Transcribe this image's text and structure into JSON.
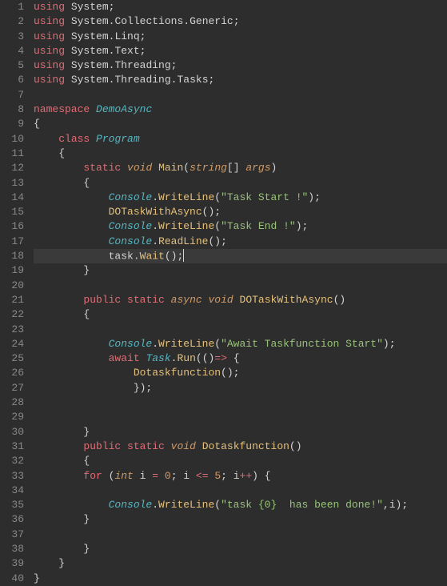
{
  "editor": {
    "cursor_line": 18,
    "line_count": 40,
    "lines": [
      [
        [
          1,
          "using"
        ],
        [
          0,
          " "
        ],
        [
          5,
          "System"
        ],
        [
          0,
          ";"
        ]
      ],
      [
        [
          1,
          "using"
        ],
        [
          0,
          " "
        ],
        [
          5,
          "System"
        ],
        [
          0,
          "."
        ],
        [
          5,
          "Collections"
        ],
        [
          0,
          "."
        ],
        [
          5,
          "Generic"
        ],
        [
          0,
          ";"
        ]
      ],
      [
        [
          1,
          "using"
        ],
        [
          0,
          " "
        ],
        [
          5,
          "System"
        ],
        [
          0,
          "."
        ],
        [
          5,
          "Linq"
        ],
        [
          0,
          ";"
        ]
      ],
      [
        [
          1,
          "using"
        ],
        [
          0,
          " "
        ],
        [
          5,
          "System"
        ],
        [
          0,
          "."
        ],
        [
          5,
          "Text"
        ],
        [
          0,
          ";"
        ]
      ],
      [
        [
          1,
          "using"
        ],
        [
          0,
          " "
        ],
        [
          5,
          "System"
        ],
        [
          0,
          "."
        ],
        [
          5,
          "Threading"
        ],
        [
          0,
          ";"
        ]
      ],
      [
        [
          1,
          "using"
        ],
        [
          0,
          " "
        ],
        [
          5,
          "System"
        ],
        [
          0,
          "."
        ],
        [
          5,
          "Threading"
        ],
        [
          0,
          "."
        ],
        [
          5,
          "Tasks"
        ],
        [
          0,
          ";"
        ]
      ],
      [],
      [
        [
          1,
          "namespace"
        ],
        [
          0,
          " "
        ],
        [
          6,
          "DemoAsync"
        ]
      ],
      [
        [
          0,
          "{"
        ]
      ],
      [
        [
          0,
          "    "
        ],
        [
          1,
          "class"
        ],
        [
          0,
          " "
        ],
        [
          6,
          "Program"
        ]
      ],
      [
        [
          0,
          "    {"
        ]
      ],
      [
        [
          0,
          "        "
        ],
        [
          1,
          "static"
        ],
        [
          0,
          " "
        ],
        [
          2,
          "void"
        ],
        [
          0,
          " "
        ],
        [
          3,
          "Main"
        ],
        [
          0,
          "("
        ],
        [
          2,
          "string"
        ],
        [
          0,
          "[] "
        ],
        [
          7,
          "args"
        ],
        [
          0,
          ")"
        ]
      ],
      [
        [
          0,
          "        {"
        ]
      ],
      [
        [
          0,
          "            "
        ],
        [
          6,
          "Console"
        ],
        [
          0,
          "."
        ],
        [
          3,
          "WriteLine"
        ],
        [
          0,
          "("
        ],
        [
          4,
          "\"Task Start !\""
        ],
        [
          0,
          ");"
        ]
      ],
      [
        [
          0,
          "            "
        ],
        [
          3,
          "DOTaskWithAsync"
        ],
        [
          0,
          "();"
        ]
      ],
      [
        [
          0,
          "            "
        ],
        [
          6,
          "Console"
        ],
        [
          0,
          "."
        ],
        [
          3,
          "WriteLine"
        ],
        [
          0,
          "("
        ],
        [
          4,
          "\"Task End !\""
        ],
        [
          0,
          ");"
        ]
      ],
      [
        [
          0,
          "            "
        ],
        [
          6,
          "Console"
        ],
        [
          0,
          "."
        ],
        [
          3,
          "ReadLine"
        ],
        [
          0,
          "();"
        ]
      ],
      [
        [
          0,
          "            "
        ],
        [
          5,
          "task"
        ],
        [
          0,
          "."
        ],
        [
          3,
          "Wait"
        ],
        [
          0,
          "();"
        ]
      ],
      [
        [
          0,
          "        }"
        ]
      ],
      [],
      [
        [
          0,
          "        "
        ],
        [
          1,
          "public"
        ],
        [
          0,
          " "
        ],
        [
          1,
          "static"
        ],
        [
          0,
          " "
        ],
        [
          2,
          "async"
        ],
        [
          0,
          " "
        ],
        [
          2,
          "void"
        ],
        [
          0,
          " "
        ],
        [
          3,
          "DOTaskWithAsync"
        ],
        [
          0,
          "()"
        ]
      ],
      [
        [
          0,
          "        {"
        ]
      ],
      [],
      [
        [
          0,
          "            "
        ],
        [
          6,
          "Console"
        ],
        [
          0,
          "."
        ],
        [
          3,
          "WriteLine"
        ],
        [
          0,
          "("
        ],
        [
          4,
          "\"Await Taskfunction Start\""
        ],
        [
          0,
          ");"
        ]
      ],
      [
        [
          0,
          "            "
        ],
        [
          1,
          "await"
        ],
        [
          0,
          " "
        ],
        [
          6,
          "Task"
        ],
        [
          0,
          "."
        ],
        [
          3,
          "Run"
        ],
        [
          0,
          "(()"
        ],
        [
          1,
          "=>"
        ],
        [
          0,
          " {"
        ]
      ],
      [
        [
          0,
          "                "
        ],
        [
          3,
          "Dotaskfunction"
        ],
        [
          0,
          "();"
        ]
      ],
      [
        [
          0,
          "                });"
        ]
      ],
      [],
      [],
      [
        [
          0,
          "        }"
        ]
      ],
      [
        [
          0,
          "        "
        ],
        [
          1,
          "public"
        ],
        [
          0,
          " "
        ],
        [
          1,
          "static"
        ],
        [
          0,
          " "
        ],
        [
          2,
          "void"
        ],
        [
          0,
          " "
        ],
        [
          3,
          "Dotaskfunction"
        ],
        [
          0,
          "()"
        ]
      ],
      [
        [
          0,
          "        {"
        ]
      ],
      [
        [
          0,
          "        "
        ],
        [
          1,
          "for"
        ],
        [
          0,
          " ("
        ],
        [
          2,
          "int"
        ],
        [
          0,
          " i "
        ],
        [
          1,
          "="
        ],
        [
          0,
          " "
        ],
        [
          8,
          "0"
        ],
        [
          0,
          "; i "
        ],
        [
          1,
          "<="
        ],
        [
          0,
          " "
        ],
        [
          8,
          "5"
        ],
        [
          0,
          "; i"
        ],
        [
          1,
          "++"
        ],
        [
          0,
          ") {"
        ]
      ],
      [],
      [
        [
          0,
          "            "
        ],
        [
          6,
          "Console"
        ],
        [
          0,
          "."
        ],
        [
          3,
          "WriteLine"
        ],
        [
          0,
          "("
        ],
        [
          4,
          "\"task {0}  has been done!\""
        ],
        [
          0,
          ",i);"
        ]
      ],
      [
        [
          0,
          "        }"
        ]
      ],
      [],
      [
        [
          0,
          "        }"
        ]
      ],
      [
        [
          0,
          "    }"
        ]
      ],
      [
        [
          0,
          "}"
        ]
      ]
    ],
    "token_classes": {
      "0": "t-white",
      "1": "t-pink",
      "2": "t-orange",
      "3": "t-yellow",
      "4": "t-green",
      "5": "t-white",
      "6": "t-italic-teal",
      "7": "t-orange",
      "8": "t-num"
    }
  }
}
